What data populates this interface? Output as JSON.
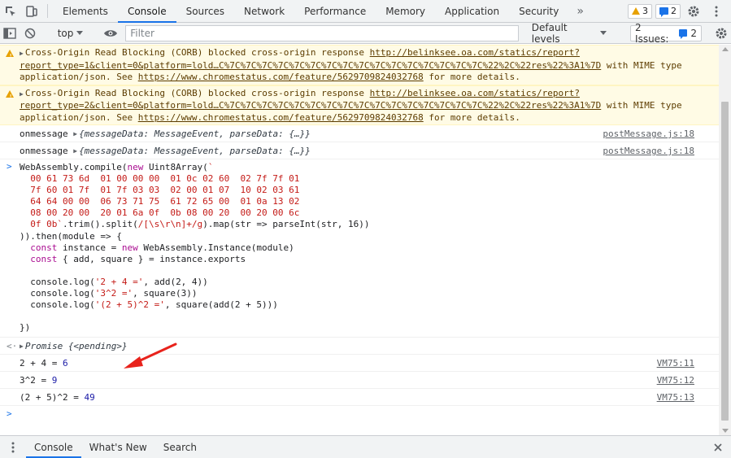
{
  "tabs": {
    "items": [
      "Elements",
      "Console",
      "Sources",
      "Network",
      "Performance",
      "Memory",
      "Application",
      "Security"
    ],
    "more": "»",
    "warning_count": "3",
    "message_count": "2"
  },
  "toolbar": {
    "context": "top",
    "filter_placeholder": "Filter",
    "levels": "Default levels",
    "issues_label": "2 Issues:",
    "issues_count": "2"
  },
  "warnings": [
    {
      "text_a": "Cross-Origin Read Blocking (CORB) blocked cross-origin response ",
      "url": "http://belinksee.oa.com/statics/report?report_type=1&client=0&platform=lold…C%7C%7C%7C%7C%7C%7C%7C%7C%7C%7C%7C%7C%7C%7C%7C%7C%22%2C%22res%22%3A1%7D",
      "text_b": " with MIME type application/json. See ",
      "link": "https://www.chromestatus.com/feature/5629709824032768",
      "text_c": " for more details."
    },
    {
      "text_a": "Cross-Origin Read Blocking (CORB) blocked cross-origin response ",
      "url": "http://belinksee.oa.com/statics/report?report_type=2&client=0&platform=lold…C%7C%7C%7C%7C%7C%7C%7C%7C%7C%7C%7C%7C%7C%7C%7C%7C%22%2C%22res%22%3A1%7D",
      "text_b": " with MIME type application/json. See ",
      "link": "https://www.chromestatus.com/feature/5629709824032768",
      "text_c": " for more details."
    }
  ],
  "logs": [
    {
      "label": "onmessage",
      "object": "{messageData: MessageEvent, parseData: {…}}",
      "source": "postMessage.js:18"
    },
    {
      "label": "onmessage",
      "object": "{messageData: MessageEvent, parseData: {…}}",
      "source": "postMessage.js:18"
    }
  ],
  "code": {
    "l1a": "WebAssembly.compile(",
    "l1k": "new",
    "l1b": " Uint8Array(",
    "l1s": "`",
    "hex": [
      "  00 61 73 6d  01 00 00 00  01 0c 02 60  02 7f 7f 01",
      "  7f 60 01 7f  01 7f 03 03  02 00 01 07  10 02 03 61",
      "  64 64 00 00  06 73 71 75  61 72 65 00  01 0a 13 02",
      "  08 00 20 00  20 01 6a 0f  0b 08 00 20  00 20 00 6c"
    ],
    "l6s": "  0f 0b`",
    "l6a": ".trim().split(",
    "l6r": "/[\\s\\r\\n]+/g",
    "l6b": ").map(str => parseInt(str, 16))",
    "l7": ")).then(module => {",
    "l8k": "  const",
    "l8a": " instance = ",
    "l8k2": "new",
    "l8b": " WebAssembly.Instance(module)",
    "l9k": "  const",
    "l9a": " { add, square } = instance.exports",
    "l11a": "  console.log(",
    "l11s": "'2 + 4 ='",
    "l11b": ", add(2, 4))",
    "l12a": "  console.log(",
    "l12s": "'3^2 ='",
    "l12b": ", square(3))",
    "l13a": "  console.log(",
    "l13s": "'(2 + 5)^2 ='",
    "l13b": ", square(add(2 + 5)))",
    "l15": "})"
  },
  "promise": {
    "label": "Promise",
    "state": "{<pending>}"
  },
  "results": [
    {
      "text": "2 + 4 =",
      "value": "6",
      "source": "VM75:11"
    },
    {
      "text": "3^2 =",
      "value": "9",
      "source": "VM75:12"
    },
    {
      "text": "(2 + 5)^2 =",
      "value": "49",
      "source": "VM75:13"
    }
  ],
  "drawer": {
    "tabs": [
      "Console",
      "What's New",
      "Search"
    ]
  }
}
